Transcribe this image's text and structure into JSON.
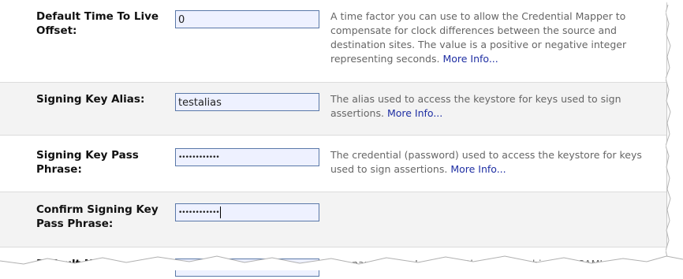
{
  "rows": [
    {
      "label": "Default Time To Live Offset:",
      "value": "0",
      "description": "A time factor you can use to allow the Credential Mapper to compensate for clock differences between the source and destination sites. The value is a positive or negative integer representing seconds.",
      "more": "More Info..."
    },
    {
      "label": "Signing Key Alias:",
      "value": "testalias",
      "description": "The alias used to access the keystore for keys used to sign assertions.",
      "more": "More Info..."
    },
    {
      "label": "Signing Key Pass Phrase:",
      "value": "••••••••••••",
      "description": "The credential (password) used to access the keystore for keys used to sign assertions.",
      "more": "More Info..."
    },
    {
      "label": "Confirm Signing Key Pass Phrase:",
      "value": "••••••••••••"
    },
    {
      "label": "Default Name",
      "value": "",
      "description": "The name of the Java class that maps Subjects to SAML"
    }
  ]
}
